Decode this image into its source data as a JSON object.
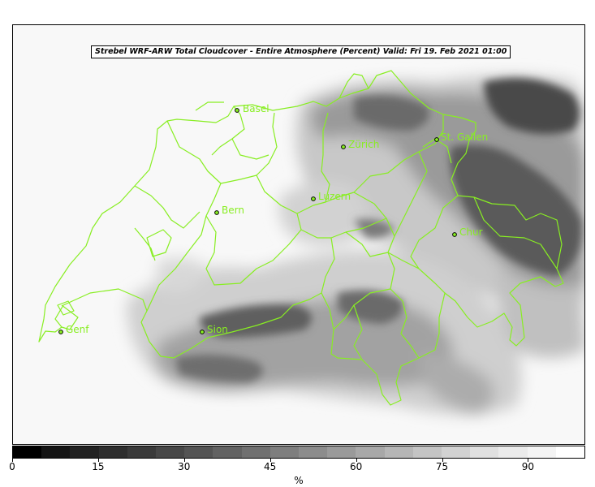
{
  "title": "Strebel WRF-ARW Total Cloudcover - Entire Atmosphere (Percent)   Valid: Fri 19. Feb 2021 01:00",
  "colors": {
    "border": "#88ee22",
    "city_label": "#88ee22",
    "background": "#f8f8f8"
  },
  "cities": [
    {
      "name": "Basel"
    },
    {
      "name": "Zürich"
    },
    {
      "name": "St. Gallen"
    },
    {
      "name": "Bern"
    },
    {
      "name": "Luzern"
    },
    {
      "name": "Chur"
    },
    {
      "name": "Genf"
    },
    {
      "name": "Sion"
    }
  ],
  "colorbar": {
    "unit": "%",
    "min": 0,
    "max": 100,
    "step": 5,
    "tick_labels": [
      "0",
      "15",
      "30",
      "45",
      "60",
      "75",
      "90"
    ],
    "colors": [
      "#000000",
      "#141414",
      "#222222",
      "#2e2e2e",
      "#3a3a3a",
      "#474747",
      "#545454",
      "#626262",
      "#707070",
      "#7e7e7e",
      "#8c8c8c",
      "#9a9a9a",
      "#a8a8a8",
      "#b6b6b6",
      "#c4c4c4",
      "#d2d2d2",
      "#e0e0e0",
      "#ebebeb",
      "#f4f4f4",
      "#ffffff"
    ]
  }
}
